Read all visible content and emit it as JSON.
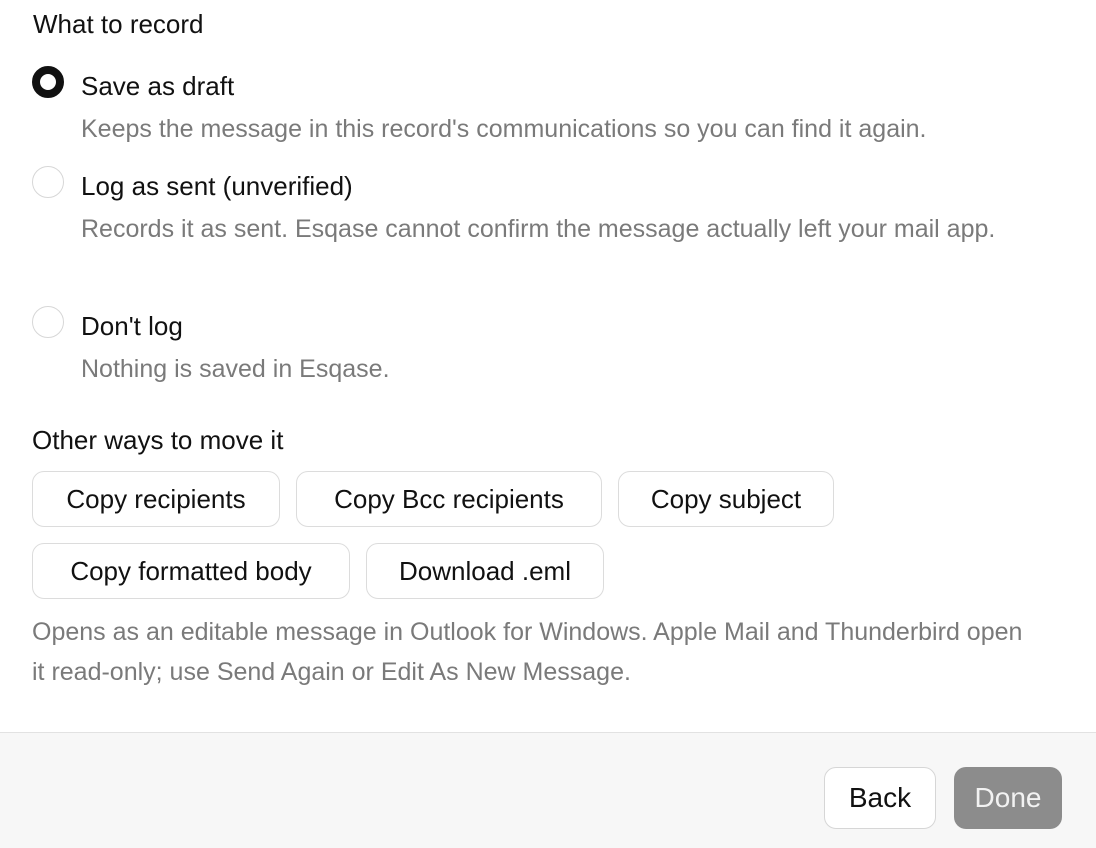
{
  "record": {
    "title": "What to record",
    "options": [
      {
        "label": "Save as draft",
        "description": "Keeps the message in this record's communications so you can find it again.",
        "selected": true
      },
      {
        "label": "Log as sent (unverified)",
        "description": "Records it as sent. Esqase cannot confirm the message actually left your mail app.",
        "selected": false
      },
      {
        "label": "Don't log",
        "description": "Nothing is saved in Esqase.",
        "selected": false
      }
    ]
  },
  "other": {
    "title": "Other ways to move it",
    "buttons": [
      "Copy recipients",
      "Copy Bcc recipients",
      "Copy subject",
      "Copy formatted body",
      "Download .eml"
    ],
    "note": "Opens as an editable message in Outlook for Windows. Apple Mail and Thunderbird open it read-only; use Send Again or Edit As New Message."
  },
  "footer": {
    "back_label": "Back",
    "done_label": "Done"
  }
}
